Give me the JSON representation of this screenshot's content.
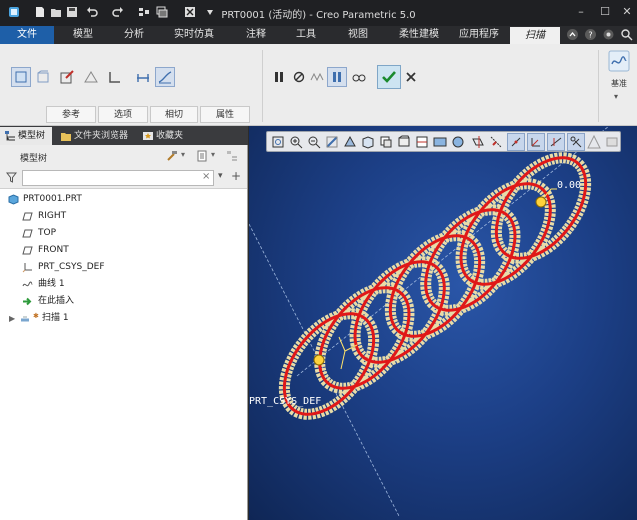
{
  "window": {
    "title": "PRT0001 (活动的) - Creo Parametric 5.0"
  },
  "ribbon_tabs": [
    {
      "label": "文件",
      "active": false
    },
    {
      "label": "模型",
      "active": false
    },
    {
      "label": "分析",
      "active": false
    },
    {
      "label": "实时仿真",
      "active": false
    },
    {
      "label": "注释",
      "active": false
    },
    {
      "label": "工具",
      "active": false
    },
    {
      "label": "视图",
      "active": false
    },
    {
      "label": "柔性建模",
      "active": false
    },
    {
      "label": "应用程序",
      "active": false
    },
    {
      "label": "扫描",
      "active": true
    }
  ],
  "ribbon": {
    "subtabs": [
      "参考",
      "选项",
      "相切",
      "属性"
    ],
    "sketch_label": "基准"
  },
  "left_panel": {
    "tabs": [
      "模型树",
      "文件夹浏览器",
      "收藏夹"
    ],
    "tree_header": "模型树",
    "search_placeholder": "",
    "tree_items": [
      {
        "label": "PRT0001.PRT",
        "icon": "part-icon"
      },
      {
        "label": "RIGHT",
        "icon": "datum-plane-icon"
      },
      {
        "label": "TOP",
        "icon": "datum-plane-icon"
      },
      {
        "label": "FRONT",
        "icon": "datum-plane-icon"
      },
      {
        "label": "PRT_CSYS_DEF",
        "icon": "csys-icon"
      },
      {
        "label": "曲线 1",
        "icon": "curve-icon"
      },
      {
        "label": "在此插入",
        "icon": "insert-here-icon"
      },
      {
        "label": "扫描 1",
        "icon": "sweep-icon"
      }
    ]
  },
  "viewport": {
    "dimension_label": "0.00",
    "csys_label": "PRT_CSYS_DEF",
    "colors": {
      "background": "#1c3f86",
      "sweep_rope": "#e8dca8",
      "trajectory": "#e01818"
    }
  }
}
